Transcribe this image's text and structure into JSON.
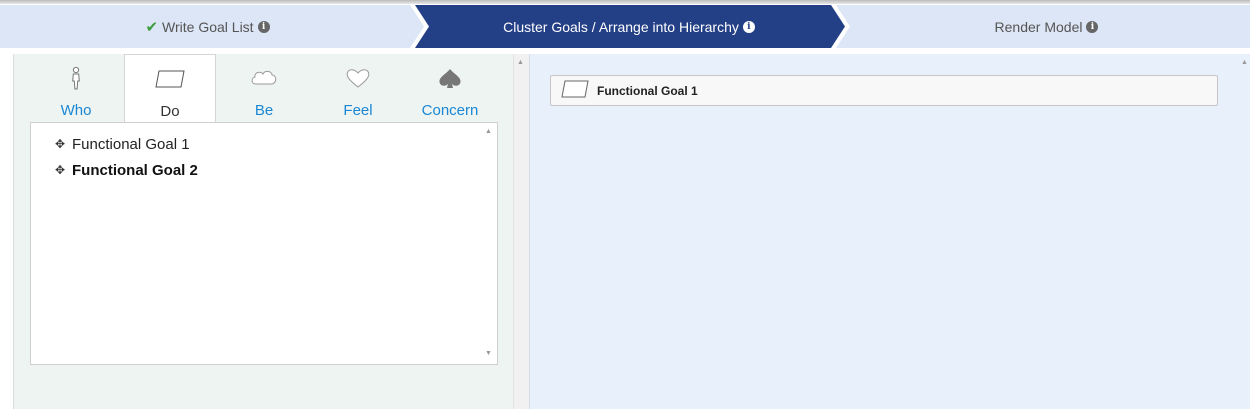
{
  "steps": [
    {
      "label": "Write Goal List",
      "state": "done",
      "icon": "check-icon"
    },
    {
      "label": "Cluster Goals / Arrange into Hierarchy",
      "state": "active"
    },
    {
      "label": "Render Model",
      "state": "pending"
    }
  ],
  "colors": {
    "step_inactive_bg": "#dde6f6",
    "step_active_bg": "#233f86",
    "tab_link": "#1a87d6",
    "left_panel_bg": "#edf4f1",
    "right_panel_bg": "#e8f1fb",
    "check": "#3e9c3e"
  },
  "tabs": [
    {
      "label": "Who",
      "icon": "person-icon",
      "active": false
    },
    {
      "label": "Do",
      "icon": "parallelogram-icon",
      "active": true
    },
    {
      "label": "Be",
      "icon": "cloud-icon",
      "active": false
    },
    {
      "label": "Feel",
      "icon": "heart-icon",
      "active": false
    },
    {
      "label": "Concern",
      "icon": "spade-icon",
      "active": false
    }
  ],
  "goal_list": [
    {
      "label": "Functional Goal 1",
      "bold": false
    },
    {
      "label": "Functional Goal 2",
      "bold": true
    }
  ],
  "hierarchy": [
    {
      "label": "Functional Goal 1",
      "icon": "parallelogram-icon"
    }
  ]
}
